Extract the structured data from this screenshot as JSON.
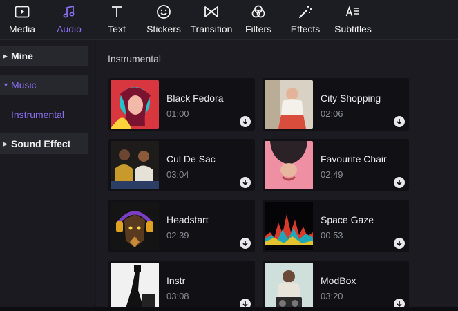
{
  "toolbar": {
    "tabs": [
      {
        "label": "Media",
        "icon": "media-icon"
      },
      {
        "label": "Audio",
        "icon": "music-note-icon",
        "active": true
      },
      {
        "label": "Text",
        "icon": "text-icon"
      },
      {
        "label": "Stickers",
        "icon": "smiley-icon"
      },
      {
        "label": "Transition",
        "icon": "bowtie-icon"
      },
      {
        "label": "Filters",
        "icon": "filters-icon"
      },
      {
        "label": "Effects",
        "icon": "magic-wand-icon"
      },
      {
        "label": "Subtitles",
        "icon": "subtitles-icon"
      }
    ]
  },
  "sidebar": {
    "items": [
      {
        "label": "Mine",
        "state": "collapsed"
      },
      {
        "label": "Music",
        "state": "expanded"
      },
      {
        "label": "Sound Effect",
        "state": "collapsed"
      }
    ],
    "sub_items": [
      {
        "label": "Instrumental",
        "selected": true
      }
    ]
  },
  "content": {
    "section_title": "Instrumental",
    "tracks": [
      {
        "name": "Black Fedora",
        "duration": "01:00"
      },
      {
        "name": "City Shopping",
        "duration": "02:06"
      },
      {
        "name": "Cul De Sac",
        "duration": "03:04"
      },
      {
        "name": "Favourite Chair",
        "duration": "02:49"
      },
      {
        "name": "Headstart",
        "duration": "02:39"
      },
      {
        "name": "Space Gaze",
        "duration": "00:53"
      },
      {
        "name": "Instr",
        "duration": "03:08"
      },
      {
        "name": "ModBox",
        "duration": "03:20"
      }
    ]
  },
  "colors": {
    "accent": "#8a6ff0",
    "background": "#16161c",
    "card": "#101015",
    "sidebar_item": "#27272e"
  }
}
